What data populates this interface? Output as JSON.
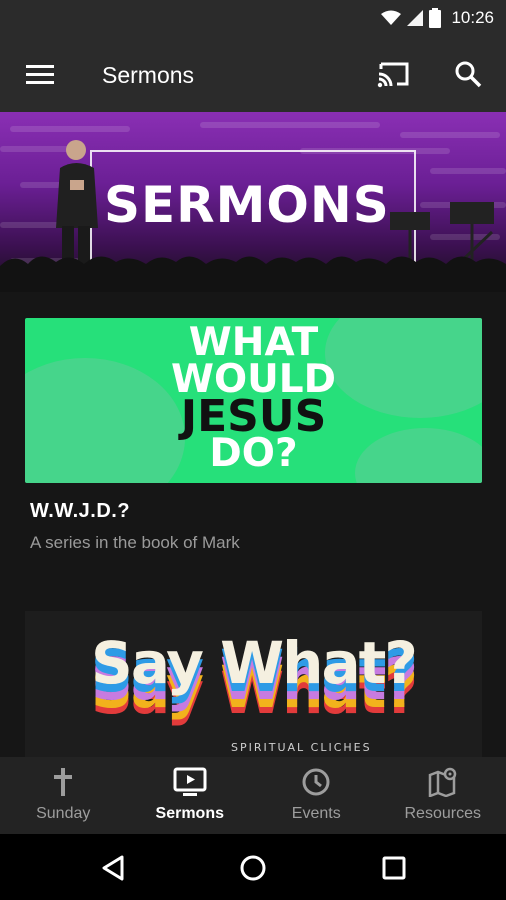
{
  "status_bar": {
    "time": "10:26"
  },
  "app_bar": {
    "title": "Sermons",
    "menu_icon": "menu-icon",
    "cast_icon": "cast-icon",
    "search_icon": "search-icon"
  },
  "banner": {
    "text": "SERMONS"
  },
  "series": [
    {
      "art_lines": [
        "WHAT",
        "WOULD",
        "JESUS",
        "DO?"
      ],
      "title": "W.W.J.D.?",
      "subtitle": "A series in the book of Mark"
    },
    {
      "art_title": "Say What?",
      "art_subtitle": "SPIRITUAL CLICHES"
    }
  ],
  "bottom_nav": {
    "items": [
      {
        "label": "Sunday",
        "icon": "cross-icon",
        "active": false
      },
      {
        "label": "Sermons",
        "icon": "tv-play-icon",
        "active": true
      },
      {
        "label": "Events",
        "icon": "clock-icon",
        "active": false
      },
      {
        "label": "Resources",
        "icon": "map-pin-icon",
        "active": false
      }
    ]
  },
  "colors": {
    "app_bar": "#2b2b2b",
    "background": "#161616",
    "wwjd_green": "#26e07a",
    "banner_purple": "#8a2fb4"
  }
}
